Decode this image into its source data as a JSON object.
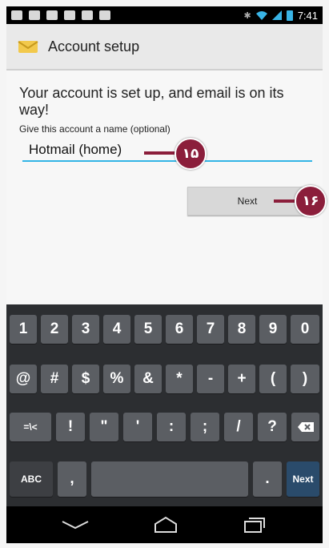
{
  "status_bar": {
    "time": "7:41"
  },
  "action_bar": {
    "title": "Account setup"
  },
  "content": {
    "message": "Your account is set up, and email is on its way!",
    "name_hint": "Give this account a name (optional)",
    "account_name_value": "Hotmail (home)",
    "next_label": "Next"
  },
  "callouts": {
    "c15": "۱۵",
    "c16": "۱۶"
  },
  "keyboard": {
    "row1": [
      "1",
      "2",
      "3",
      "4",
      "5",
      "6",
      "7",
      "8",
      "9",
      "0"
    ],
    "row2": [
      "@",
      "#",
      "$",
      "%",
      "&",
      "*",
      "-",
      "+",
      "(",
      ")"
    ],
    "row3": [
      "=\\<",
      "!",
      "\"",
      "'",
      ":",
      ";",
      "/",
      "?"
    ],
    "abc_label": "ABC",
    "comma_label": ",",
    "period_label": ".",
    "next_label": "Next"
  },
  "colors": {
    "accent": "#33b5e5",
    "callout": "#8b1e3b",
    "keyboard_bg": "#2c2e31",
    "key": "#5b5e63",
    "next_key": "#2a4b6b"
  }
}
